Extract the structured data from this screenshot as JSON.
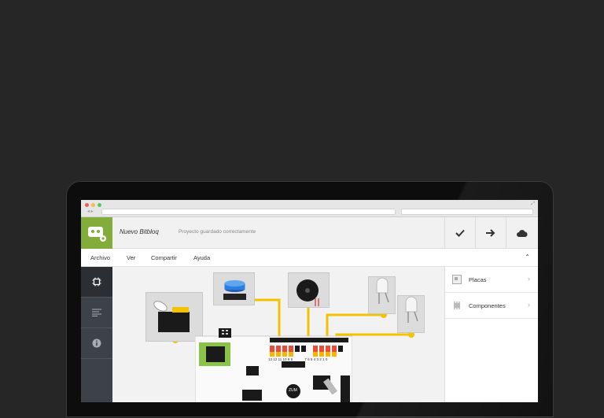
{
  "header": {
    "project_name": "Nuevo Bitbloq",
    "project_status": "Proyecto guardado correctamente",
    "actions": [
      {
        "name": "check-icon"
      },
      {
        "name": "arrow-right-icon"
      },
      {
        "name": "cloud-icon"
      }
    ]
  },
  "menu": {
    "items": [
      "Archivo",
      "Ver",
      "Compartir",
      "Ayuda"
    ]
  },
  "sidebar": {
    "items": [
      {
        "name": "hardware-chip-icon",
        "active": true
      },
      {
        "name": "code-lines-icon",
        "active": false
      },
      {
        "name": "info-icon",
        "active": false
      }
    ]
  },
  "panel": {
    "items": [
      {
        "label": "Placas",
        "icon": "board-icon"
      },
      {
        "label": "Componentes",
        "icon": "component-icon"
      }
    ]
  },
  "board": {
    "top_pins": [
      "13",
      "12",
      "11",
      "10",
      "9",
      "8",
      "7",
      "6",
      "5",
      "4",
      "3",
      "2",
      "1",
      "0"
    ],
    "logo_text": "ZUM"
  },
  "colors": {
    "accent": "#82ad3a",
    "wire": "#f3c300",
    "sidebar": "#3d4148",
    "background": "#262626"
  }
}
